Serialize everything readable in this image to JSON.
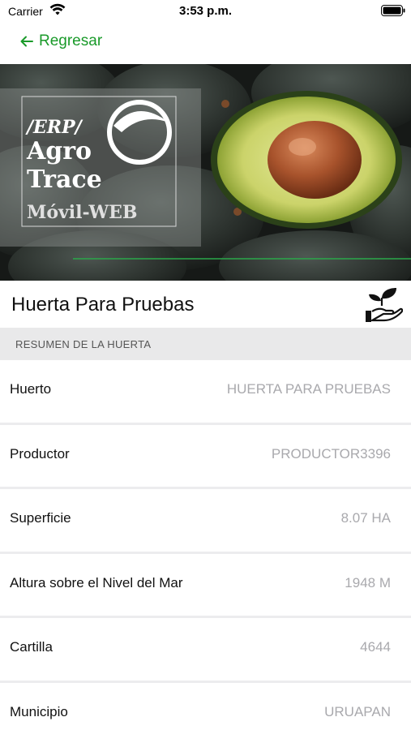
{
  "status_bar": {
    "carrier": "Carrier",
    "time": "3:53 p.m."
  },
  "nav": {
    "back_label": "Regresar",
    "accent_color": "#1a9a2a"
  },
  "hero": {
    "logo_line1": "/ERP/",
    "logo_line2": "Agro",
    "logo_line3": "Trace",
    "logo_line4": "Móvil-WEB"
  },
  "page": {
    "title": "Huerta Para Pruebas",
    "icon": "plant-in-hand-icon"
  },
  "section": {
    "header": "RESUMEN DE LA HUERTA"
  },
  "rows": [
    {
      "label": "Huerto",
      "value": "HUERTA PARA PRUEBAS"
    },
    {
      "label": "Productor",
      "value": "PRODUCTOR3396"
    },
    {
      "label": "Superficie",
      "value": "8.07 HA"
    },
    {
      "label": "Altura sobre el Nivel del Mar",
      "value": "1948 M"
    },
    {
      "label": "Cartilla",
      "value": "4644"
    },
    {
      "label": "Municipio",
      "value": "URUAPAN"
    }
  ]
}
